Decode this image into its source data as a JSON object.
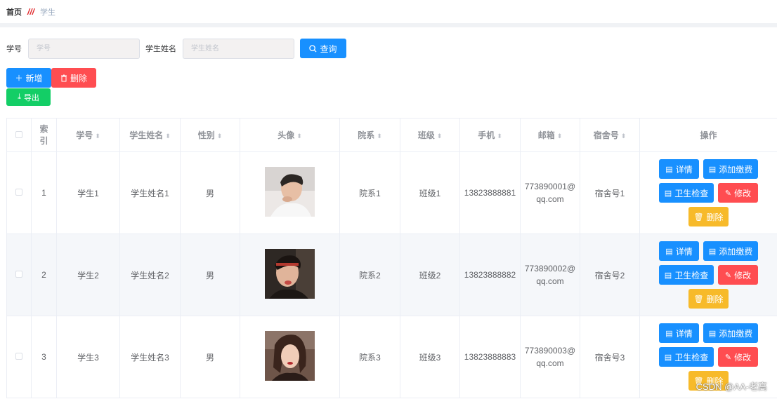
{
  "breadcrumb": {
    "home": "首页",
    "separator": "///",
    "current": "学生"
  },
  "search": {
    "field1_label": "学号",
    "field1_placeholder": "学号",
    "field2_label": "学生姓名",
    "field2_placeholder": "学生姓名",
    "query_label": "查询"
  },
  "toolbar": {
    "add_label": "新增",
    "delete_label": "删除",
    "export_label": "导出"
  },
  "table": {
    "headers": {
      "index": "索引",
      "student_no": "学号",
      "student_name": "学生姓名",
      "gender": "性别",
      "avatar": "头像",
      "department": "院系",
      "class": "班级",
      "phone": "手机",
      "email": "邮箱",
      "dorm": "宿舍号",
      "actions": "操作"
    },
    "rows": [
      {
        "index": "1",
        "student_no": "学生1",
        "student_name": "学生姓名1",
        "gender": "男",
        "department": "院系1",
        "class": "班级1",
        "phone": "13823888881",
        "email_l1": "773890001@",
        "email_l2": "qq.com",
        "dorm": "宿舍号1"
      },
      {
        "index": "2",
        "student_no": "学生2",
        "student_name": "学生姓名2",
        "gender": "男",
        "department": "院系2",
        "class": "班级2",
        "phone": "13823888882",
        "email_l1": "773890002@",
        "email_l2": "qq.com",
        "dorm": "宿舍号2"
      },
      {
        "index": "3",
        "student_no": "学生3",
        "student_name": "学生姓名3",
        "gender": "男",
        "department": "院系3",
        "class": "班级3",
        "phone": "13823888883",
        "email_l1": "773890003@",
        "email_l2": "qq.com",
        "dorm": "宿舍号3"
      }
    ],
    "row_actions": {
      "detail": "详情",
      "add_payment": "添加缴费",
      "health_check": "卫生检查",
      "edit": "修改",
      "remove": "删除"
    }
  },
  "watermark": "CSDN @AA-老高",
  "colors": {
    "primary": "#1890ff",
    "danger": "#ff4d51",
    "success": "#13ce66",
    "warning": "#f7ba2a",
    "stripe": "#f5f7fa"
  },
  "icons": {
    "query": "search-icon",
    "add": "plus-icon",
    "delete": "trash-icon",
    "export": "download-icon",
    "detail": "document-icon",
    "edit": "pencil-icon",
    "sort": "sort-caret-icon"
  }
}
